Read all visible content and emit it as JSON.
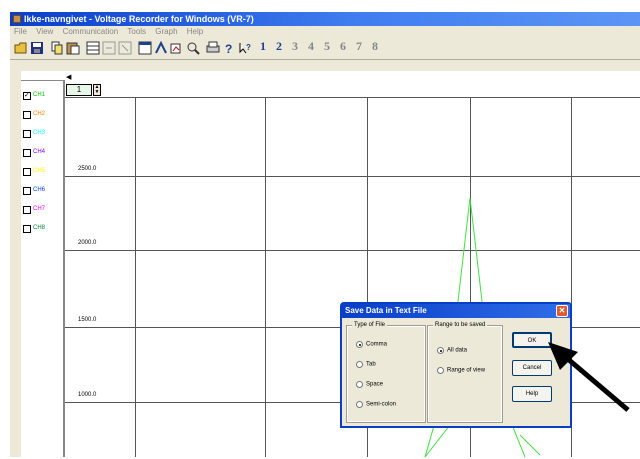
{
  "window": {
    "title": "Ikke-navngivet - Voltage Recorder for Windows (VR-7)"
  },
  "menu": [
    "File",
    "View",
    "Communication",
    "Tools",
    "Graph",
    "Help"
  ],
  "toolbar": {
    "icons": [
      "open-icon",
      "save-icon",
      "copy-icon",
      "paste-icon",
      "grid-icon",
      "zoom-in-icon",
      "zoom-out-icon",
      "window-icon",
      "measure-icon",
      "copy-graph-icon",
      "marker-icon",
      "print-icon",
      "help-icon",
      "whats-this-icon"
    ],
    "channel_buttons": [
      "1",
      "2",
      "3",
      "4",
      "5",
      "6",
      "7",
      "8"
    ]
  },
  "channels": [
    {
      "label": "CH1",
      "color": "#00c000",
      "checked": true
    },
    {
      "label": "CH2",
      "color": "#ff8000",
      "checked": false
    },
    {
      "label": "CH3",
      "color": "#00ffff",
      "checked": false
    },
    {
      "label": "CH4",
      "color": "#8000ff",
      "checked": false
    },
    {
      "label": "CH5",
      "color": "#ffff00",
      "checked": false
    },
    {
      "label": "CH6",
      "color": "#0040ff",
      "checked": false
    },
    {
      "label": "CH7",
      "color": "#ff00ff",
      "checked": false
    },
    {
      "label": "CH8",
      "color": "#008040",
      "checked": false
    }
  ],
  "graph": {
    "zoom_value": "1",
    "y_ticks": [
      "2500.0",
      "2000.0",
      "1500.0",
      "1000.0"
    ],
    "line_color": "#40e040"
  },
  "dialog": {
    "title": "Save Data in Text File",
    "type_group": {
      "title": "Type of File",
      "options": [
        "Comma",
        "Tab",
        "Space",
        "Semi-colon"
      ],
      "selected": 0
    },
    "range_group": {
      "title": "Range to be saved",
      "options": [
        "All data",
        "Range of view"
      ],
      "selected": 0
    },
    "buttons": {
      "ok": "OK",
      "cancel": "Cancel",
      "help": "Help"
    }
  }
}
